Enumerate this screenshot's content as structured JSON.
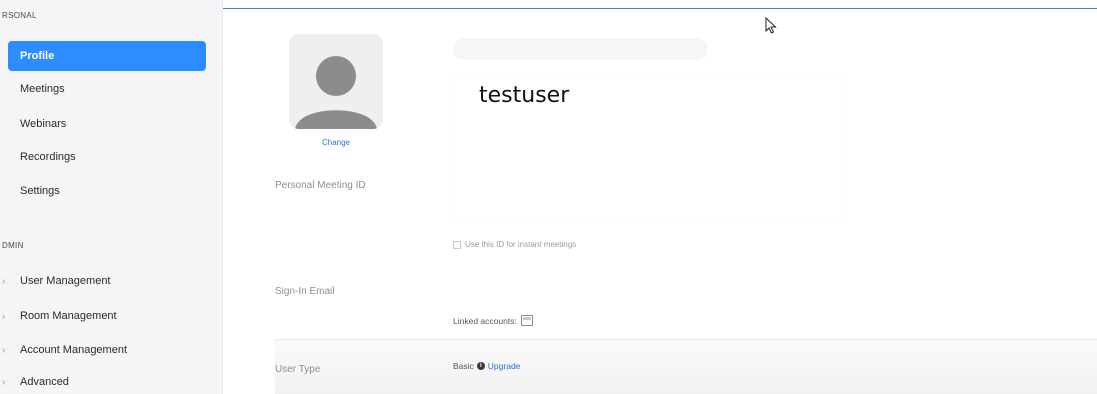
{
  "sidebar": {
    "personal_label": "RSONAL",
    "admin_label": "DMIN",
    "personal_items": [
      {
        "label": "Profile",
        "active": true
      },
      {
        "label": "Meetings",
        "active": false
      },
      {
        "label": "Webinars",
        "active": false
      },
      {
        "label": "Recordings",
        "active": false
      },
      {
        "label": "Settings",
        "active": false
      }
    ],
    "admin_items": [
      {
        "label": "User Management"
      },
      {
        "label": "Room Management"
      },
      {
        "label": "Account Management"
      },
      {
        "label": "Advanced"
      }
    ]
  },
  "profile": {
    "change_label": "Change",
    "username": "testuser",
    "personal_meeting_id_label": "Personal Meeting ID",
    "use_id_label": "Use this ID for instant meetings",
    "sign_in_email_label": "Sign-In Email",
    "linked_accounts_label": "Linked accounts:",
    "user_type_label": "User Type",
    "user_type_value": "Basic",
    "upgrade_label": "Upgrade"
  },
  "colors": {
    "accent": "#2d8cff",
    "link": "#2d6fd6"
  }
}
